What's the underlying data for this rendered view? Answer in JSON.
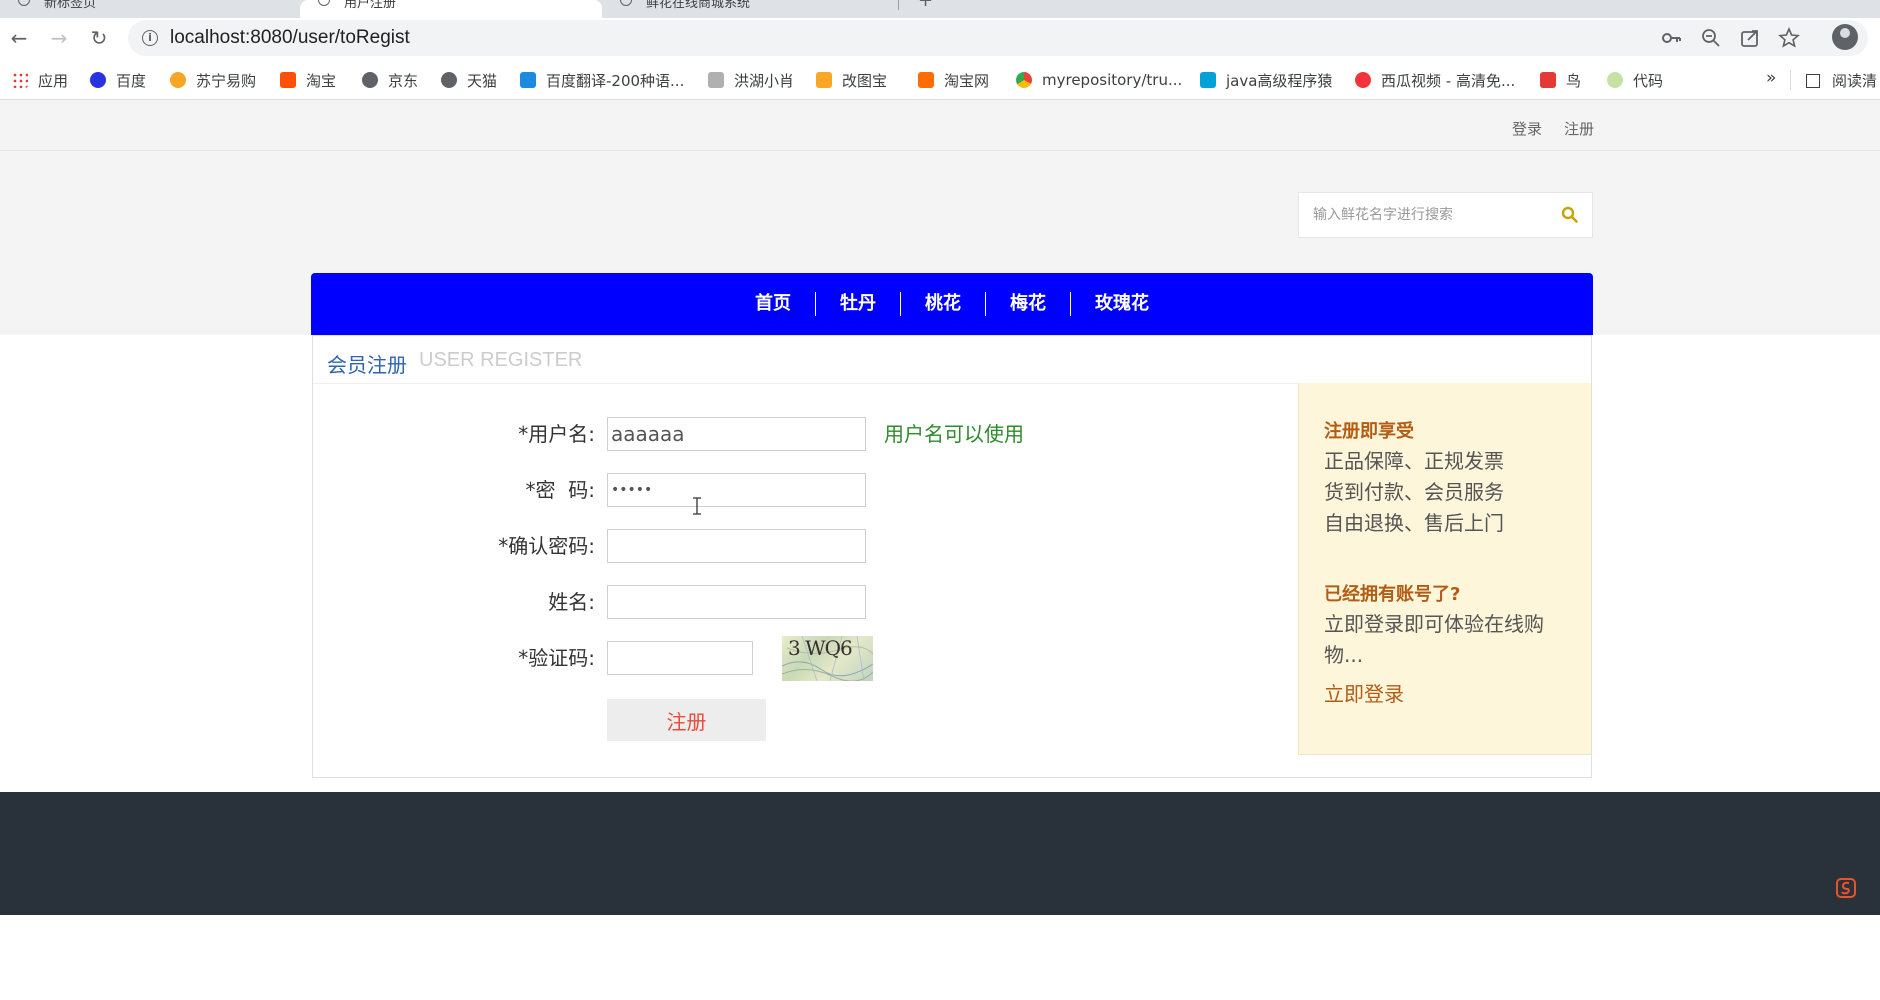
{
  "browser": {
    "tabs": [
      {
        "title": "新标签页"
      },
      {
        "title": "用户注册"
      },
      {
        "title": "鲜花在线商城系统"
      }
    ],
    "new_tab": "+",
    "url": "localhost:8080/user/toRegist",
    "bookmarks": [
      {
        "label": "应用",
        "color": "#e53935"
      },
      {
        "label": "百度",
        "color": "#2932e1"
      },
      {
        "label": "苏宁易购",
        "color": "#f5a623"
      },
      {
        "label": "淘宝",
        "color": "#ff5000"
      },
      {
        "label": "京东",
        "color": "#5f6368"
      },
      {
        "label": "天猫",
        "color": "#5f6368"
      },
      {
        "label": "百度翻译-200种语...",
        "color": "#1e88e5"
      },
      {
        "label": "洪湖小肖",
        "color": "#8e8e8e"
      },
      {
        "label": "改图宝",
        "color": "#f9a825"
      },
      {
        "label": "淘宝网",
        "color": "#ff6d00"
      },
      {
        "label": "myrepository/tru...",
        "color": "#43a047"
      },
      {
        "label": "java高级程序猿",
        "color": "#00a1d6"
      },
      {
        "label": "西瓜视频 - 高清免...",
        "color": "#f4333c"
      },
      {
        "label": "鸟",
        "color": "#e53935"
      },
      {
        "label": "代码",
        "color": "#c5e1a5"
      }
    ],
    "bookmarks_more": "»",
    "reading_list": "阅读清"
  },
  "site": {
    "top_links": {
      "login": "登录",
      "register": "注册"
    },
    "search": {
      "placeholder": "输入鲜花名字进行搜索"
    },
    "nav": [
      "首页",
      "牡丹",
      "桃花",
      "梅花",
      "玫瑰花"
    ],
    "register": {
      "title_cn": "会员注册",
      "title_en": "USER REGISTER",
      "fields": {
        "username": {
          "label": "*用户名:",
          "value": "aaaaaa",
          "hint": "用户名可以使用"
        },
        "password": {
          "label": "*密  码:",
          "value": "•••••"
        },
        "confirm": {
          "label": "*确认密码:",
          "value": ""
        },
        "name": {
          "label": "姓名:",
          "value": ""
        },
        "captcha": {
          "label": "*验证码:",
          "value": "",
          "image_text": "3 WQ6"
        }
      },
      "submit": "注册"
    },
    "benefits": {
      "heading1": "注册即享受",
      "lines": [
        "正品保障、正规发票",
        "货到付款、会员服务",
        "自由退换、售后上门"
      ],
      "heading2": "已经拥有账号了?",
      "text2": "立即登录即可体验在线购物...",
      "link": "立即登录"
    }
  },
  "colors": {
    "nav_bg": "#0000ff",
    "accent_orange": "#b35c14",
    "hint_green": "#2e8b2e",
    "submit_red": "#e74c3c",
    "footer_bg": "#29313a",
    "benefits_bg": "#fdf6db"
  }
}
